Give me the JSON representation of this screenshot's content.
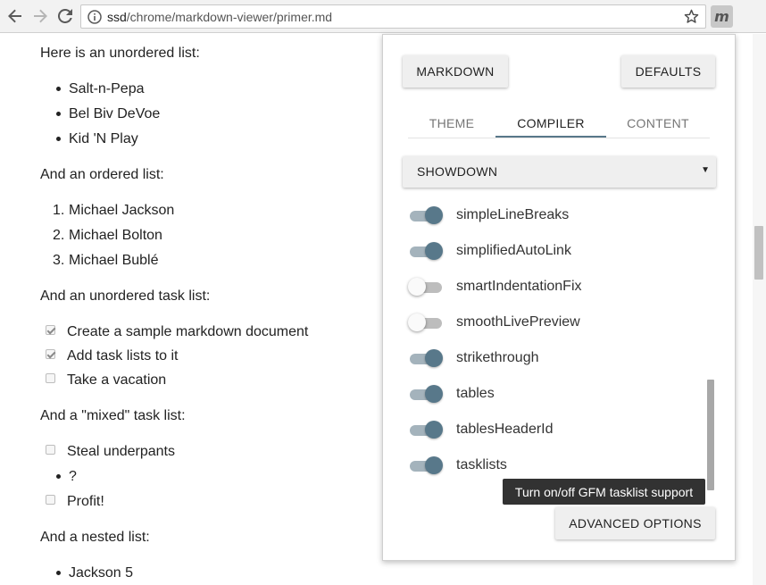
{
  "browser": {
    "url_host": "ssd",
    "url_path": "/chrome/markdown-viewer/primer.md",
    "extension_icon": "m"
  },
  "document": {
    "unordered_heading": "Here is an unordered list:",
    "unordered_items": [
      "Salt-n-Pepa",
      "Bel Biv DeVoe",
      "Kid 'N Play"
    ],
    "ordered_heading": "And an ordered list:",
    "ordered_items": [
      {
        "num": "1.",
        "text": "Michael Jackson"
      },
      {
        "num": "2.",
        "text": "Michael Bolton"
      },
      {
        "num": "3.",
        "text": "Michael Bublé"
      }
    ],
    "task_heading": "And an unordered task list:",
    "task_items": [
      {
        "text": "Create a sample markdown document",
        "checked": true
      },
      {
        "text": "Add task lists to it",
        "checked": true
      },
      {
        "text": "Take a vacation",
        "checked": false
      }
    ],
    "mixed_heading": "And a \"mixed\" task list:",
    "mixed_items": [
      "Steal underpants",
      "?",
      "Profit!"
    ],
    "nested_heading": "And a nested list:",
    "nested_items": [
      "Jackson 5"
    ]
  },
  "panel": {
    "markdown_button": "MARKDOWN",
    "defaults_button": "DEFAULTS",
    "tabs": [
      "THEME",
      "COMPILER",
      "CONTENT"
    ],
    "active_tab": "COMPILER",
    "compiler_select": "SHOWDOWN",
    "options": [
      {
        "name": "simpleLineBreaks",
        "on": true
      },
      {
        "name": "simplifiedAutoLink",
        "on": true
      },
      {
        "name": "smartIndentationFix",
        "on": false
      },
      {
        "name": "smoothLivePreview",
        "on": false
      },
      {
        "name": "strikethrough",
        "on": true
      },
      {
        "name": "tables",
        "on": true
      },
      {
        "name": "tablesHeaderId",
        "on": true
      },
      {
        "name": "tasklists",
        "on": true
      }
    ],
    "tooltip": "Turn on/off GFM tasklist support",
    "advanced_button": "ADVANCED OPTIONS"
  },
  "colors": {
    "accent": "#58788a",
    "toolbar_bg": "#f2f2f2",
    "tooltip_bg": "#323232"
  }
}
